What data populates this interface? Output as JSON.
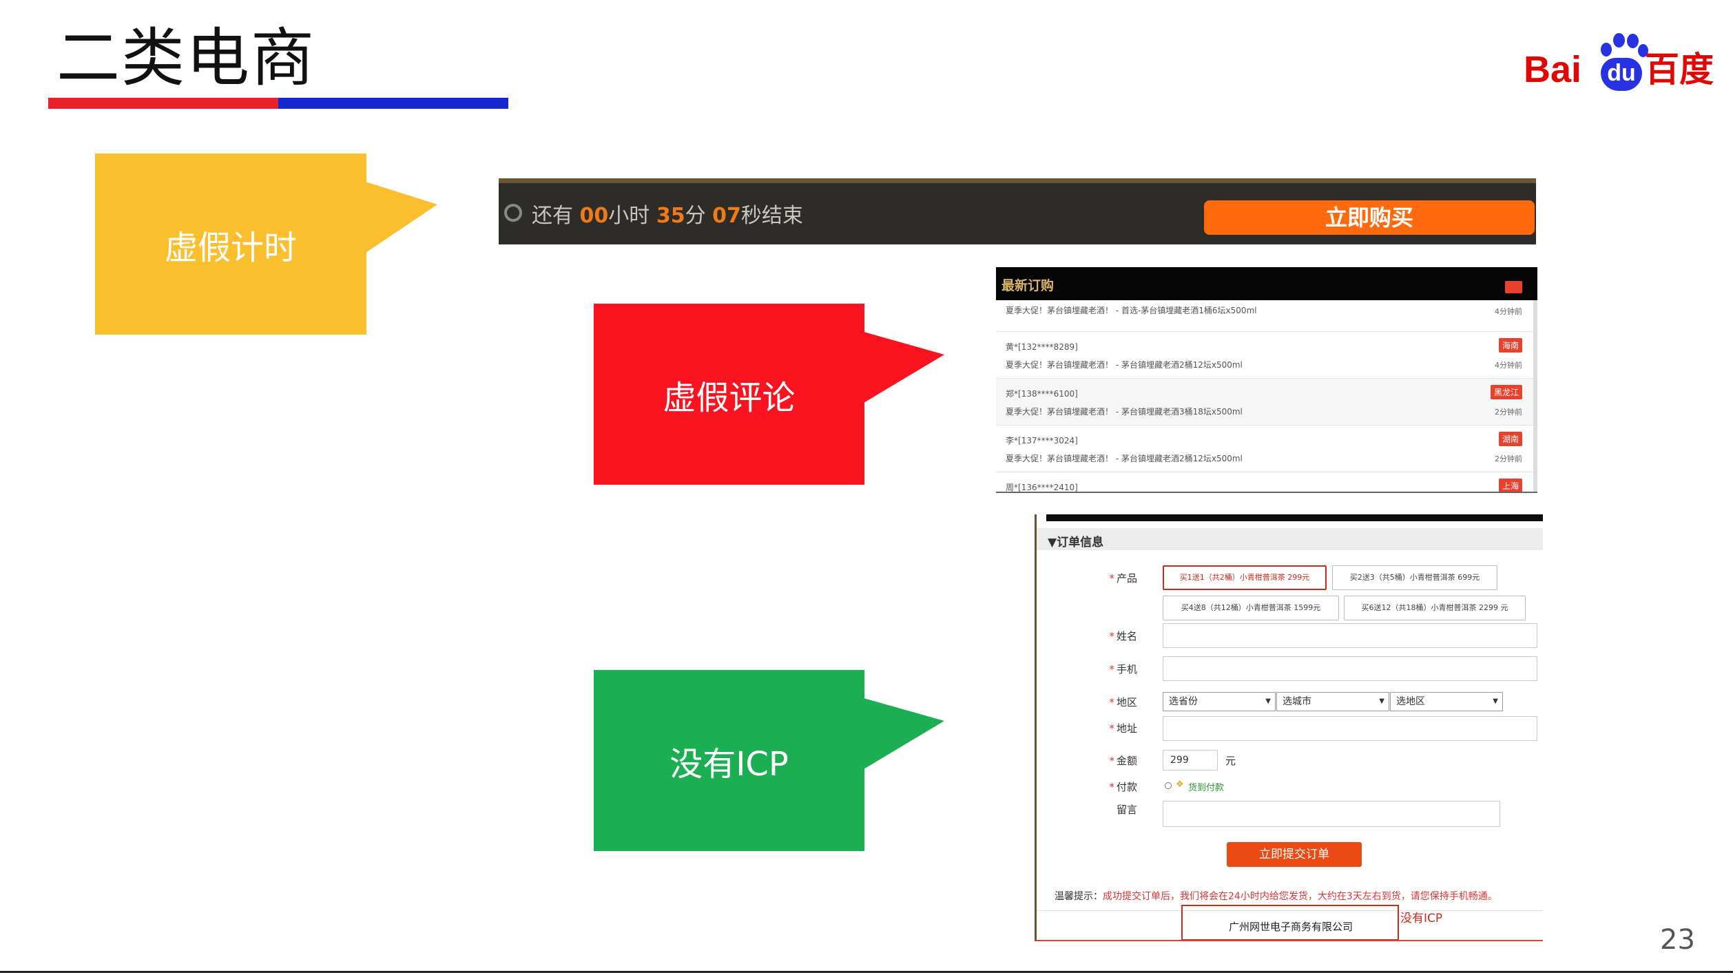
{
  "title": "二类电商",
  "logo": {
    "bai": "Bai",
    "du": "du",
    "cn": "百度"
  },
  "callouts": {
    "fake_timer": "虚假计时",
    "fake_reviews": "虚假评论",
    "no_icp": "没有ICP"
  },
  "timer": {
    "prefix": "还有 ",
    "hours": "00",
    "hours_unit": "小时 ",
    "minutes": "35",
    "minutes_unit": "分 ",
    "seconds": "07",
    "seconds_unit": "秒结束",
    "buy_label": "立即购买"
  },
  "orders": {
    "title": "最新订购",
    "rows": [
      {
        "buyer": "",
        "desc": "夏季大促！茅台镇埋藏老酒！ - 首选-茅台镇埋藏老酒1桶6坛x500ml",
        "region": "",
        "ago": "4分钟前"
      },
      {
        "buyer": "黄*[132****8289]",
        "desc": "夏季大促！茅台镇埋藏老酒！ - 茅台镇埋藏老酒2桶12坛x500ml",
        "region": "海南",
        "ago": "4分钟前"
      },
      {
        "buyer": "郑*[138****6100]",
        "desc": "夏季大促！茅台镇埋藏老酒！ - 茅台镇埋藏老酒3桶18坛x500ml",
        "region": "黑龙江",
        "ago": "2分钟前"
      },
      {
        "buyer": "李*[137****3024]",
        "desc": "夏季大促！茅台镇埋藏老酒！ - 茅台镇埋藏老酒2桶12坛x500ml",
        "region": "湖南",
        "ago": "2分钟前"
      },
      {
        "buyer": "周*[136****2410]",
        "desc": "",
        "region": "上海",
        "ago": ""
      }
    ]
  },
  "form": {
    "section_title": "▼订单信息",
    "labels": {
      "product": "产品",
      "name": "姓名",
      "phone": "手机",
      "region": "地区",
      "address": "地址",
      "amount": "金额",
      "payment": "付款",
      "message": "留言"
    },
    "required_mark": "*",
    "options": [
      "买1送1（共2桶）小青柑普洱茶  299元",
      "买2送3（共5桶）小青柑普洱茶  699元",
      "买4送8（共12桶）小青柑普洱茶  1599元",
      "买6送12（共18桶）小青柑普洱茶  2299 元"
    ],
    "selects": [
      "选省份",
      "选城市",
      "选地区"
    ],
    "amount_value": "299",
    "amount_unit": "元",
    "payment_method": "货到付款",
    "submit_label": "立即提交订单",
    "tip_label": "温馨提示：",
    "tip_text": "成功提交订单后，我们将会在24小时内给您发货，大约在3天左右到货，请您保持手机畅通。",
    "company": "广州网世电子商务有限公司",
    "no_icp": "没有ICP"
  },
  "page_number": "23"
}
